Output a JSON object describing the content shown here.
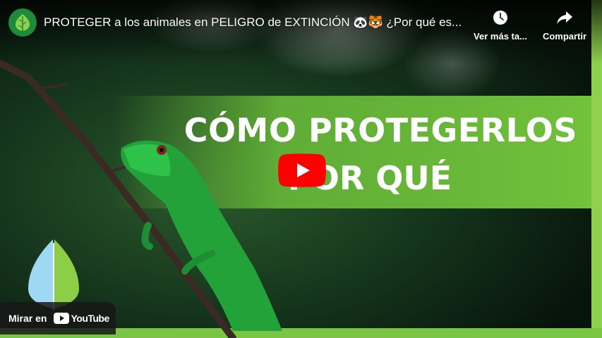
{
  "video": {
    "title": "PROTEGER a los animales en PELIGRO de EXTINCIÓN 🐼🐯 ¿Por qué es...",
    "banner_line1": "CÓMO PROTEGERLOS",
    "banner_line2": "POR QUÉ"
  },
  "actions": {
    "watch_later_label": "Ver más ta...",
    "share_label": "Compartir"
  },
  "footer": {
    "watch_on_label": "Mirar en",
    "brand_label": "YouTube"
  },
  "colors": {
    "accent_green": "#6bbf3a",
    "play_red": "#ff0000",
    "avatar_green": "#1e8a3a"
  },
  "icons": {
    "avatar": "leaf-icon",
    "watch_later": "clock-icon",
    "share": "share-arrow-icon",
    "play": "play-icon",
    "logo": "leaf-logo-icon"
  }
}
